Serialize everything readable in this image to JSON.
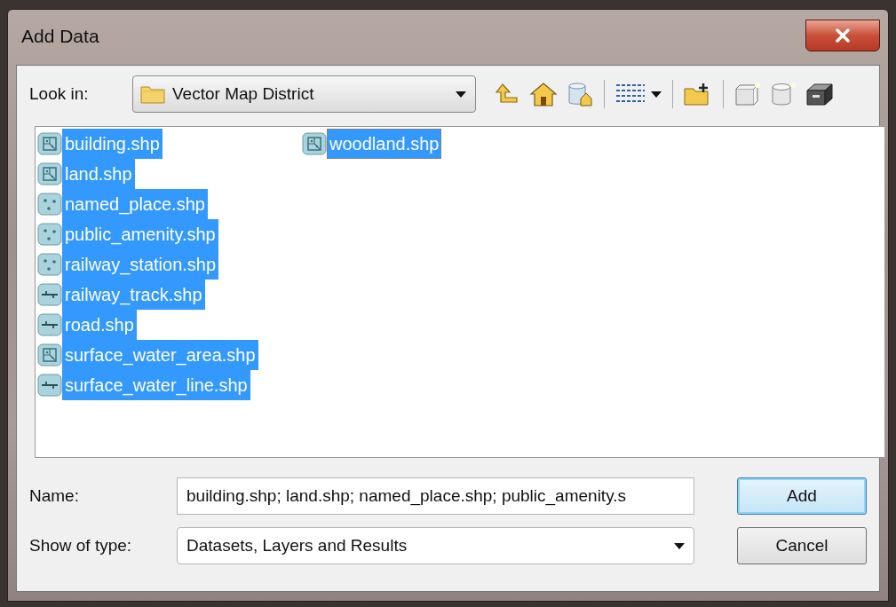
{
  "window": {
    "title": "Add Data"
  },
  "look_in": {
    "label": "Look in:",
    "value": "Vector Map District"
  },
  "files": [
    {
      "name": "building.shp",
      "kind": "polygon",
      "selected": true,
      "focused": false
    },
    {
      "name": "land.shp",
      "kind": "polygon",
      "selected": true,
      "focused": false
    },
    {
      "name": "named_place.shp",
      "kind": "point",
      "selected": true,
      "focused": false
    },
    {
      "name": "public_amenity.shp",
      "kind": "point",
      "selected": true,
      "focused": false
    },
    {
      "name": "railway_station.shp",
      "kind": "point",
      "selected": true,
      "focused": false
    },
    {
      "name": "railway_track.shp",
      "kind": "line",
      "selected": true,
      "focused": false
    },
    {
      "name": "road.shp",
      "kind": "line",
      "selected": true,
      "focused": false
    },
    {
      "name": "surface_water_area.shp",
      "kind": "polygon",
      "selected": true,
      "focused": false
    },
    {
      "name": "surface_water_line.shp",
      "kind": "line",
      "selected": true,
      "focused": false
    },
    {
      "name": "woodland.shp",
      "kind": "polygon",
      "selected": true,
      "focused": true
    }
  ],
  "name_field": {
    "label": "Name:",
    "value": "building.shp; land.shp; named_place.shp; public_amenity.s"
  },
  "type_field": {
    "label": "Show of type:",
    "value": "Datasets, Layers and Results"
  },
  "buttons": [
    {
      "label": "Add",
      "default": true
    },
    {
      "label": "Cancel",
      "default": false
    }
  ]
}
